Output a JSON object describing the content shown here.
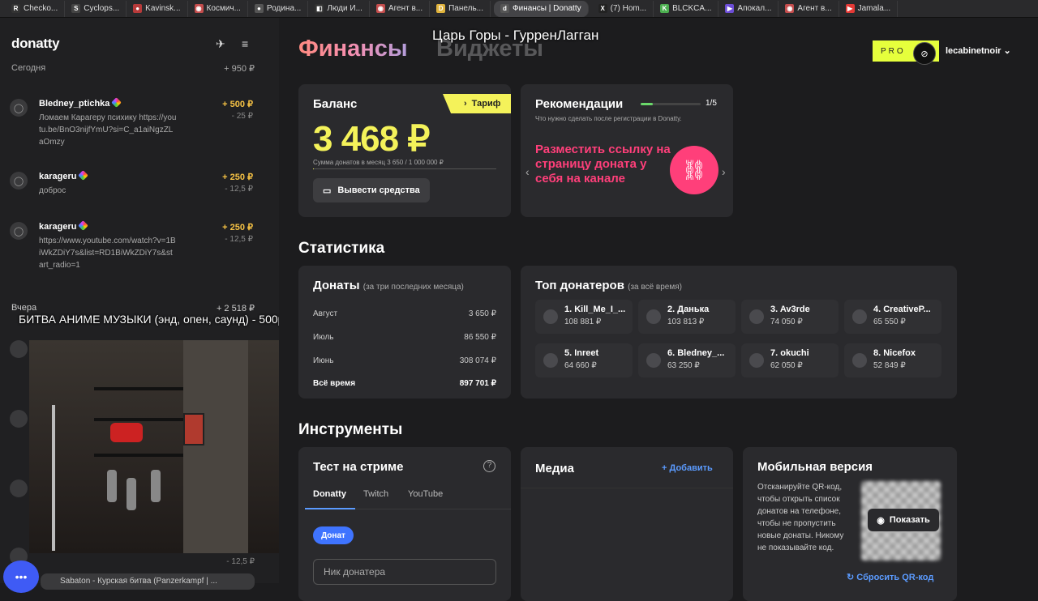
{
  "browser": {
    "tabs": [
      {
        "label": "Checko...",
        "fav": "R",
        "color": "#333333"
      },
      {
        "label": "Cyclops...",
        "fav": "S",
        "color": "#444444"
      },
      {
        "label": "Kavinsk...",
        "fav": "●",
        "color": "#b73a3a"
      },
      {
        "label": "Космич...",
        "fav": "◉",
        "color": "#c44d4d"
      },
      {
        "label": "Родина...",
        "fav": "●",
        "color": "#555555"
      },
      {
        "label": "Люди И...",
        "fav": "◧",
        "color": "#333333"
      },
      {
        "label": "Агент в...",
        "fav": "◉",
        "color": "#c44d4d"
      },
      {
        "label": "Панель...",
        "fav": "D",
        "color": "#e0b33c"
      },
      {
        "label": "Финансы | Donatty",
        "fav": "d",
        "color": "#555555"
      },
      {
        "label": "(7) Hom...",
        "fav": "X",
        "color": "#222222"
      },
      {
        "label": "BLCKCA...",
        "fav": "K",
        "color": "#4caf50"
      },
      {
        "label": "Апокал...",
        "fav": "▶",
        "color": "#6c4dd6"
      },
      {
        "label": "Агент в...",
        "fav": "◉",
        "color": "#c44d4d"
      },
      {
        "label": "Jamala...",
        "fav": "▶",
        "color": "#e53935"
      }
    ]
  },
  "sidebar": {
    "logo": "donatty",
    "today": {
      "label": "Сегодня",
      "total": "+ 950 ₽"
    },
    "donations": [
      {
        "name": "Bledney_ptichka",
        "message": "Ломаем Карагеру психику https://youtu.be/BnO3nijfYmU?si=C_a1aiNgzZLaOmzy",
        "amount": "+ 500 ₽",
        "fee": "- 25 ₽"
      },
      {
        "name": "karageru",
        "message": "доброс",
        "amount": "+ 250 ₽",
        "fee": "- 12,5 ₽"
      },
      {
        "name": "karageru",
        "message": "https://www.youtube.com/watch?v=1BiWkZDiY7s&list=RD1BiWkZDiY7s&start_radio=1",
        "amount": "+ 250 ₽",
        "fee": "- 12,5 ₽"
      }
    ],
    "yesterday": {
      "label": "Вчера",
      "total": "+ 2 518 ₽"
    },
    "bottom_fee": "- 12,5 ₽",
    "overlay_left": "БИТВА АНИМЕ МУЗЫКИ (энд, опен, саунд) - 500р",
    "yt_bar": "Sabaton - Курская битва (Panzerkampf | ..."
  },
  "main": {
    "overlay_top": "Царь Горы - ГурренЛагган",
    "tab_finance": "Финансы",
    "tab_widgets": "Виджеты",
    "pro_label": "PRO",
    "user": "lecabinetnoir",
    "balance": {
      "title": "Баланс",
      "tariff": "Тариф",
      "amount": "3 468 ₽",
      "monthly": "Сумма донатов в месяц 3 650 / 1 000 000 ₽",
      "monthly_progress": 0.00365,
      "withdraw": "Вывести средства"
    },
    "recommend": {
      "title": "Рекомендации",
      "step": "1/5",
      "step_progress": 0.2,
      "subtitle": "Что нужно сделать после регистрации в Donatty.",
      "text": "Разместить ссылку на страницу доната у себя на канале"
    },
    "stats_heading": "Статистика",
    "donations": {
      "title": "Донаты",
      "subtitle": "(за три последних месяца)",
      "rows": [
        {
          "label": "Август",
          "value": "3 650 ₽"
        },
        {
          "label": "Июль",
          "value": "86 550 ₽"
        },
        {
          "label": "Июнь",
          "value": "308 074 ₽"
        }
      ],
      "total_label": "Всё время",
      "total_value": "897 701 ₽"
    },
    "top": {
      "title": "Топ донатеров",
      "subtitle": "(за всё время)",
      "items": [
        {
          "name": "1. Kill_Me_I_...",
          "value": "108 881 ₽"
        },
        {
          "name": "2. Данька",
          "value": "103 813 ₽"
        },
        {
          "name": "3. Av3rde",
          "value": "74 050 ₽"
        },
        {
          "name": "4. CreativeP...",
          "value": "65 550 ₽"
        },
        {
          "name": "5. Inreet",
          "value": "64 660 ₽"
        },
        {
          "name": "6. Bledney_...",
          "value": "63 250 ₽"
        },
        {
          "name": "7. okuchi",
          "value": "62 050 ₽"
        },
        {
          "name": "8. Nicefox",
          "value": "52 849 ₽"
        }
      ]
    },
    "tools_heading": "Инструменты",
    "stream_test": {
      "title": "Тест на стриме",
      "tabs": [
        "Donatty",
        "Twitch",
        "YouTube"
      ],
      "chip": "Донат",
      "placeholder": "Ник донатера"
    },
    "media": {
      "title": "Медиа",
      "add": "+ Добавить"
    },
    "mobile": {
      "title": "Мобильная версия",
      "text": "Отсканируйте QR-код, чтобы открыть список донатов на телефоне, чтобы не пропустить новые донаты. Никому не показывайте код.",
      "show": "Показать",
      "reset": "Сбросить QR-код"
    }
  }
}
